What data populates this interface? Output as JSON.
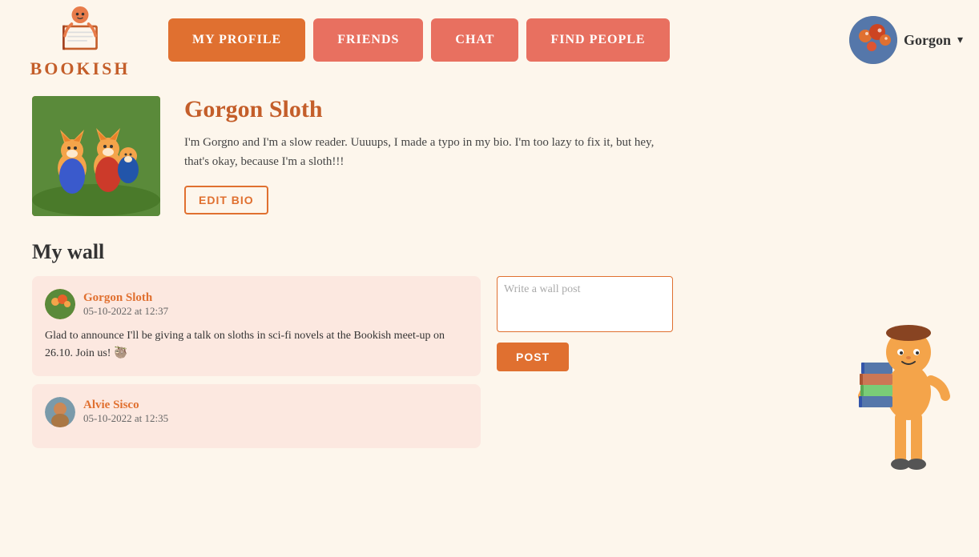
{
  "logo": {
    "text": "BOOKISH"
  },
  "nav": {
    "items": [
      {
        "label": "MY PROFILE",
        "active": true
      },
      {
        "label": "FRIENDS",
        "active": false
      },
      {
        "label": "CHAT",
        "active": false
      },
      {
        "label": "FIND PEOPLE",
        "active": false
      }
    ]
  },
  "user": {
    "name": "Gorgon",
    "chevron": "▾"
  },
  "profile": {
    "name": "Gorgon Sloth",
    "bio": "I'm Gorgno and I'm a slow reader. Uuuups, I made a typo in my bio. I'm too lazy to fix it, but hey, that's okay, because I'm a sloth!!!",
    "edit_bio_label": "EDIT BIO"
  },
  "wall": {
    "title": "My wall",
    "textarea_placeholder": "Write a wall post",
    "post_button_label": "POST",
    "posts": [
      {
        "author": "Gorgon Sloth",
        "time": "05-10-2022 at 12:37",
        "content": "Glad to announce I'll be giving a talk on sloths in sci-fi novels at the Bookish meet-up on 26.10. Join us! 🦥"
      },
      {
        "author": "Alvie Sisco",
        "time": "05-10-2022 at 12:35",
        "content": ""
      }
    ]
  }
}
